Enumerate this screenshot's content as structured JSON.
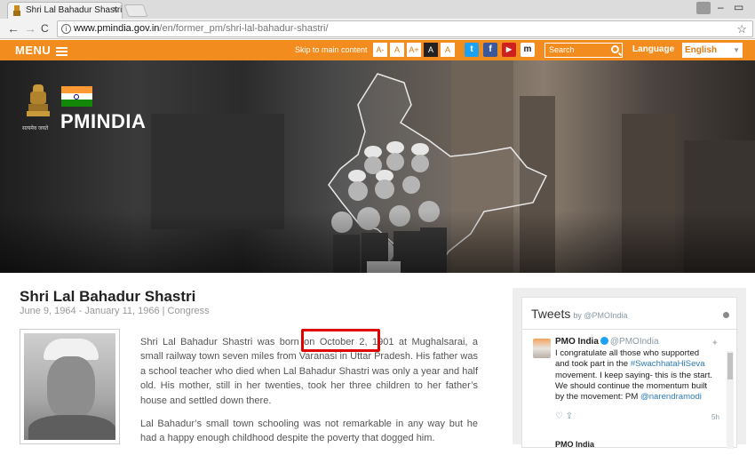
{
  "browser": {
    "tab_title": "Shri Lal Bahadur Shastri",
    "tab_close": "×",
    "url_host": "www.pmindia.gov.in",
    "url_path": "/en/former_pm/shri-lal-bahadur-shastri/",
    "back": "←",
    "forward": "→",
    "reload": "C",
    "minimize": "–",
    "restore": "▭",
    "star": "☆"
  },
  "topbar": {
    "menu_label": "MENU",
    "skip_label": "Skip to main content",
    "font_buttons": [
      "A-",
      "A",
      "A+",
      "A",
      "A"
    ],
    "social": [
      "t",
      "f",
      "▶",
      "m"
    ],
    "search_placeholder": "Search",
    "language_label": "Language",
    "language_value": "English",
    "colors": {
      "bar": "#f28c1e",
      "twitter": "#1da1f2",
      "facebook": "#3b5998",
      "youtube": "#cd201f",
      "mygov": "#222222"
    }
  },
  "hero": {
    "site_title": "PMINDIA",
    "emblem_caption": "सत्यमेव जयते"
  },
  "pm": {
    "name": "Shri Lal Bahadur Shastri",
    "meta": "June 9, 1964 - January 11, 1966 | Congress",
    "bio_p1_before": "Shri Lal Bahadur Shastri was born on ",
    "bio_p1_date": "October 2, 1901",
    "bio_p1_after": " at Mughalsarai, a small railway town seven miles from Varanasi in Uttar Pradesh. His father was a school teacher who died when Lal Bahadur Shastri was only a year and half old. His mother, still in her twenties, took her three children to her father’s house and settled down there.",
    "bio_p2": "Lal Bahadur’s small town schooling was not remarkable in any way but he had a happy enough childhood despite the poverty that dogged him."
  },
  "tweets": {
    "title": "Tweets",
    "by": "by @PMOIndia",
    "author": "PMO India",
    "handle": "@PMOIndia",
    "text_1": "I congratulate all those who supported and took part in the ",
    "hashtag": "#SwachhataHiSeva",
    "text_2": " movement. I keep saying- this is the start. We should continue the momentum built by the movement: PM ",
    "mention": "@narendramodi",
    "actions": "♡     ⇪",
    "time": "5h",
    "next_author": "PMO India"
  }
}
